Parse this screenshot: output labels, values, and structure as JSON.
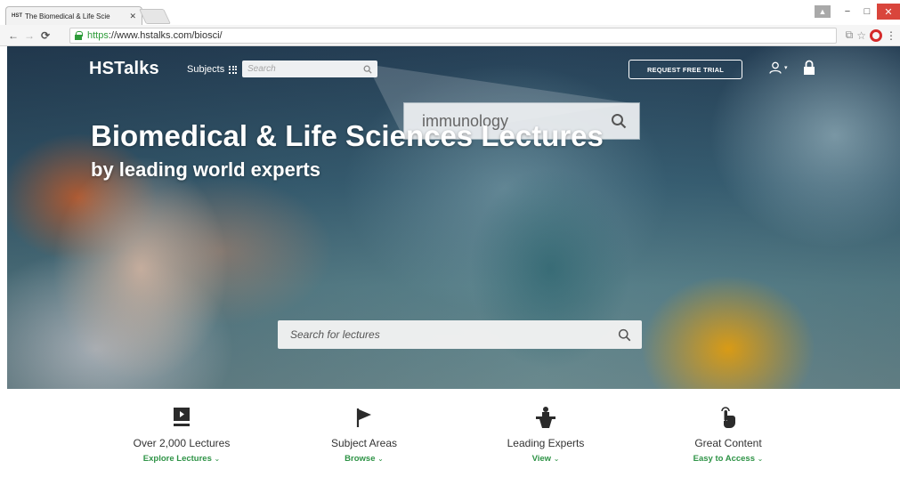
{
  "browser": {
    "tab_favicon": "HST",
    "tab_title": "The Biomedical & Life Scie",
    "tab_close": "✕",
    "url_scheme": "https",
    "url_rest": "://www.hstalks.com/biosci/",
    "window_buttons": [
      "−",
      "□",
      "✕"
    ]
  },
  "header": {
    "logo": "HSTalks",
    "subjects_label": "Subjects",
    "search_placeholder": "Search",
    "trial_button": "REQUEST FREE TRIAL",
    "user_caret": "▾"
  },
  "callout": {
    "query": "immunology"
  },
  "hero": {
    "title": "Biomedical & Life Sciences Lectures",
    "subtitle": "by leading world experts",
    "search_placeholder": "Search for lectures"
  },
  "features": [
    {
      "icon": "video-icon",
      "title": "Over 2,000 Lectures",
      "link": "Explore Lectures"
    },
    {
      "icon": "flag-icon",
      "title": "Subject Areas",
      "link": "Browse"
    },
    {
      "icon": "speaker-podium-icon",
      "title": "Leading Experts",
      "link": "View"
    },
    {
      "icon": "tap-hand-icon",
      "title": "Great Content",
      "link": "Easy to Access"
    }
  ],
  "colors": {
    "accent_green": "#2e9346",
    "secure_green": "#2e9c3a",
    "close_red": "#d9453c"
  }
}
